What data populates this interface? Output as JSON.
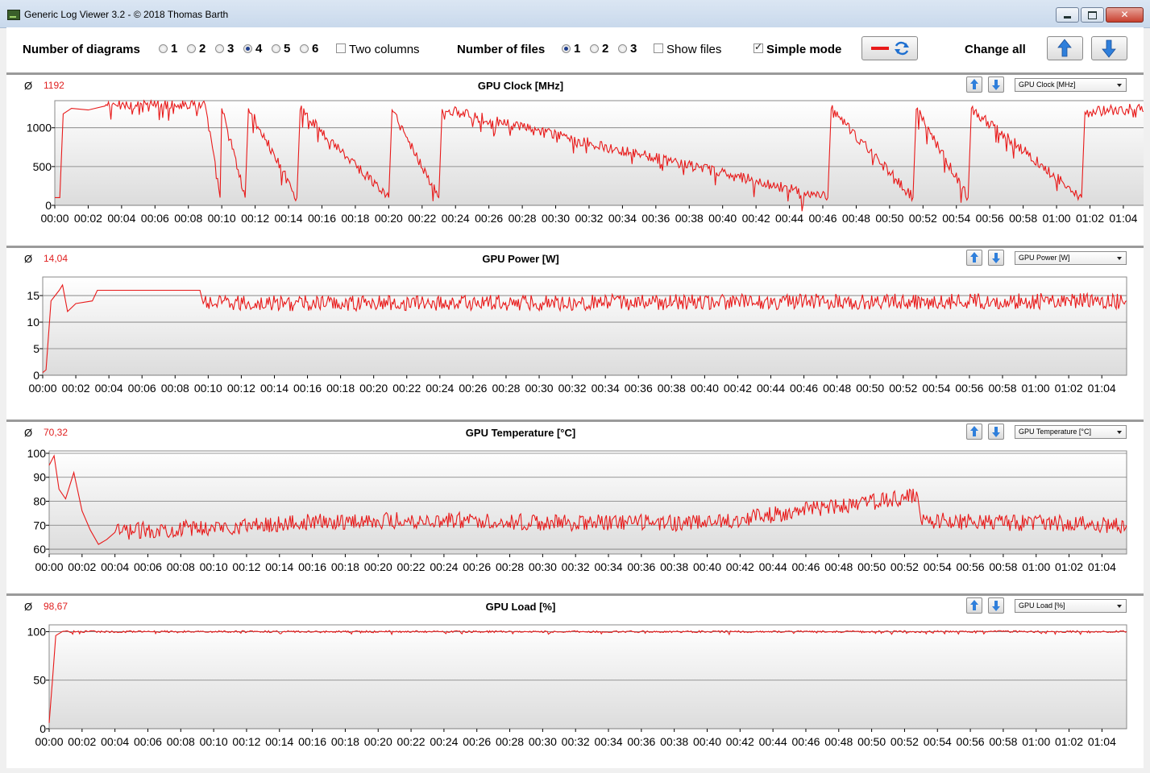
{
  "window": {
    "title": "Generic Log Viewer 3.2 - © 2018 Thomas Barth"
  },
  "toolbar": {
    "diagrams_label": "Number of diagrams",
    "diagram_options": [
      "1",
      "2",
      "3",
      "4",
      "5",
      "6"
    ],
    "diagram_selected": 3,
    "two_columns_label": "Two columns",
    "files_label": "Number of files",
    "file_options": [
      "1",
      "2",
      "3"
    ],
    "file_selected": 0,
    "show_files_label": "Show files",
    "simple_mode_label": "Simple mode",
    "change_all_label": "Change all"
  },
  "line_color": "#e81a1a",
  "x_ticks": [
    "00:00",
    "00:02",
    "00:04",
    "00:06",
    "00:08",
    "00:10",
    "00:12",
    "00:14",
    "00:16",
    "00:18",
    "00:20",
    "00:22",
    "00:24",
    "00:26",
    "00:28",
    "00:30",
    "00:32",
    "00:34",
    "00:36",
    "00:38",
    "00:40",
    "00:42",
    "00:44",
    "00:46",
    "00:48",
    "00:50",
    "00:52",
    "00:54",
    "00:56",
    "00:58",
    "01:00",
    "01:02",
    "01:04"
  ],
  "panels": [
    {
      "avg_symbol": "Ø",
      "avg": "1192",
      "title": "GPU Clock [MHz]",
      "select": "GPU Clock [MHz]"
    },
    {
      "avg_symbol": "Ø",
      "avg": "14,04",
      "title": "GPU Power [W]",
      "select": "GPU Power [W]"
    },
    {
      "avg_symbol": "Ø",
      "avg": "70,32",
      "title": "GPU Temperature [°C]",
      "select": "GPU Temperature [°C]"
    },
    {
      "avg_symbol": "Ø",
      "avg": "98,67",
      "title": "GPU Load [%]",
      "select": "GPU Load [%]"
    }
  ],
  "chart_data": [
    {
      "type": "line",
      "title": "GPU Clock [MHz]",
      "x_unit": "minutes",
      "x_range": [
        0,
        65.5
      ],
      "ylim": [
        0,
        1350
      ],
      "yticks": [
        0,
        500,
        1000
      ],
      "grid": true,
      "series": [
        {
          "values_summary": "~1200-1300 fluctuating",
          "points": [
            [
              0,
              100
            ],
            [
              0.3,
              100
            ],
            [
              0.5,
              1180
            ],
            [
              1,
              1250
            ],
            [
              2,
              1230
            ],
            [
              3,
              1280
            ],
            [
              4,
              1300
            ],
            [
              9,
              1300
            ],
            [
              9.9,
              100
            ],
            [
              10,
              1250
            ],
            [
              11.4,
              100
            ],
            [
              11.6,
              1250
            ],
            [
              14.5,
              100
            ],
            [
              14.7,
              1230
            ],
            [
              20,
              100
            ],
            [
              20.2,
              1230
            ],
            [
              23,
              100
            ],
            [
              23.2,
              1240
            ],
            [
              46.3,
              100
            ],
            [
              46.5,
              1240
            ],
            [
              51.4,
              100
            ],
            [
              51.6,
              1240
            ],
            [
              54.7,
              100
            ],
            [
              54.9,
              1250
            ],
            [
              61.5,
              100
            ],
            [
              61.7,
              1200
            ],
            [
              65.3,
              1250
            ]
          ]
        }
      ]
    },
    {
      "type": "line",
      "title": "GPU Power [W]",
      "x_unit": "minutes",
      "x_range": [
        0,
        65.5
      ],
      "ylim": [
        0,
        18.5
      ],
      "yticks": [
        0,
        5,
        10,
        15
      ],
      "grid": true,
      "series": [
        {
          "points": [
            [
              0,
              0.5
            ],
            [
              0.2,
              1
            ],
            [
              0.5,
              14
            ],
            [
              1,
              16
            ],
            [
              1.2,
              17
            ],
            [
              1.5,
              12
            ],
            [
              2,
              13.5
            ],
            [
              3,
              14
            ],
            [
              3.3,
              16
            ],
            [
              9.5,
              16
            ],
            [
              9.7,
              13.5
            ],
            [
              65.5,
              14
            ]
          ]
        }
      ]
    },
    {
      "type": "line",
      "title": "GPU Temperature [°C]",
      "x_unit": "minutes",
      "x_range": [
        0,
        65.5
      ],
      "ylim": [
        58,
        101
      ],
      "yticks": [
        60,
        70,
        80,
        90,
        100
      ],
      "grid": true,
      "series": [
        {
          "points": [
            [
              0,
              95
            ],
            [
              0.3,
              99
            ],
            [
              0.6,
              85
            ],
            [
              1,
              81
            ],
            [
              1.5,
              92
            ],
            [
              2,
              76
            ],
            [
              2.5,
              68
            ],
            [
              3,
              62
            ],
            [
              3.5,
              64
            ],
            [
              4,
              67
            ],
            [
              6,
              68
            ],
            [
              10,
              69
            ],
            [
              15,
              71
            ],
            [
              20,
              72
            ],
            [
              26,
              72
            ],
            [
              30,
              71
            ],
            [
              40,
              71
            ],
            [
              52.8,
              82
            ],
            [
              53,
              72
            ],
            [
              65.5,
              70
            ]
          ]
        }
      ]
    },
    {
      "type": "line",
      "title": "GPU Load [%]",
      "x_unit": "minutes",
      "x_range": [
        0,
        65.5
      ],
      "ylim": [
        0,
        107
      ],
      "yticks": [
        0,
        50,
        100
      ],
      "grid": true,
      "series": [
        {
          "points": [
            [
              0,
              6
            ],
            [
              0.2,
              50
            ],
            [
              0.4,
              96
            ],
            [
              0.8,
              100
            ],
            [
              65.5,
              100
            ]
          ]
        }
      ]
    }
  ]
}
